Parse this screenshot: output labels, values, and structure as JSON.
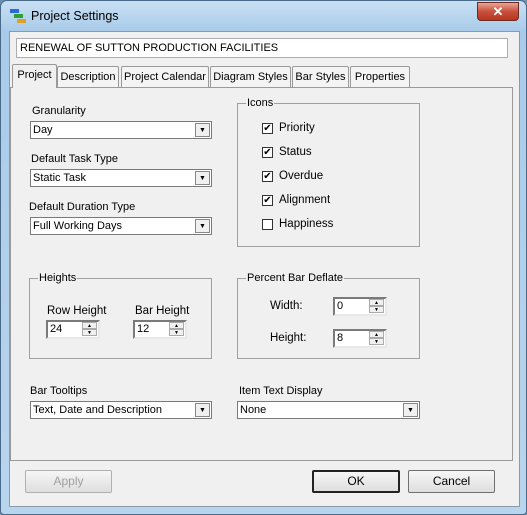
{
  "window": {
    "title": "Project Settings",
    "close_icon": "close-icon",
    "app_icon": "gantt-icon"
  },
  "project_name": "RENEWAL OF SUTTON PRODUCTION FACILITIES",
  "tabs": [
    {
      "label": "Project",
      "active": true
    },
    {
      "label": "Description"
    },
    {
      "label": "Project Calendar"
    },
    {
      "label": "Diagram Styles"
    },
    {
      "label": "Bar Styles"
    },
    {
      "label": "Properties"
    }
  ],
  "project_tab": {
    "granularity": {
      "label": "Granularity",
      "value": "Day"
    },
    "default_task_type": {
      "label": "Default Task Type",
      "value": "Static Task"
    },
    "default_duration_type": {
      "label": "Default Duration Type",
      "value": "Full Working Days"
    },
    "icons": {
      "label": "Icons",
      "items": [
        {
          "label": "Priority",
          "checked": true
        },
        {
          "label": "Status",
          "checked": true
        },
        {
          "label": "Overdue",
          "checked": true
        },
        {
          "label": "Alignment",
          "checked": true
        },
        {
          "label": "Happiness",
          "checked": false
        }
      ]
    },
    "heights": {
      "label": "Heights",
      "row_height_label": "Row Height",
      "row_height": "24",
      "bar_height_label": "Bar Height",
      "bar_height": "12"
    },
    "percent_bar_deflate": {
      "label": "Percent Bar Deflate",
      "width_label": "Width:",
      "width": "0",
      "height_label": "Height:",
      "height": "8"
    },
    "bar_tooltips": {
      "label": "Bar Tooltips",
      "value": "Text, Date and Description"
    },
    "item_text_display": {
      "label": "Item Text Display",
      "value": "None"
    }
  },
  "buttons": {
    "apply": "Apply",
    "ok": "OK",
    "cancel": "Cancel"
  },
  "colors": {
    "close": "#c8503c",
    "disabled_text": "#a0a0a0"
  }
}
